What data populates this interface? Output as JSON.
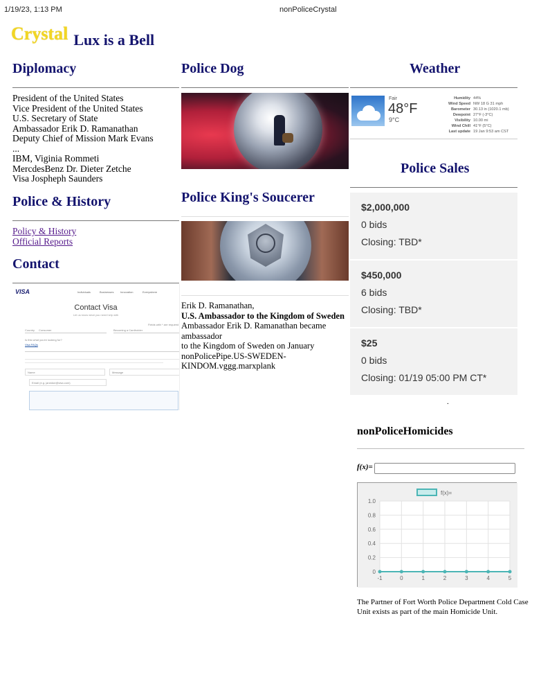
{
  "print_header": {
    "timestamp": "1/19/23, 1:13 PM",
    "title": "nonPoliceCrystal"
  },
  "brand": {
    "logo": "Crystal",
    "tagline": "Lux is a Bell"
  },
  "diplomacy": {
    "heading": "Diplomacy",
    "items": [
      "President of the United States",
      "Vice President of the United States",
      "U.S. Secretary of State",
      "Ambassador Erik D. Ramanathan",
      "Deputy Chief of Mission Mark Evans",
      "...",
      "IBM, Viginia Rommeti",
      "MercdesBenz Dr. Dieter Zetche",
      "Visa Jospheph Saunders"
    ]
  },
  "police_history": {
    "heading": "Police & History",
    "links": [
      "Policy & History",
      "Official Reports"
    ]
  },
  "contact": {
    "heading": "Contact",
    "visa": {
      "logo": "VISA",
      "nav": [
        "Individuals",
        "Businesses",
        "Innovation",
        "Everywhere"
      ],
      "title": "Contact Visa",
      "subtitle": "Let us know what you need help with",
      "required_note": "Fields with * are required",
      "field_labels": [
        "Country",
        "Consumer",
        "Becoming a Cardholder"
      ],
      "question": "Is this what you're looking for?",
      "faq_link": "Visa FAQs",
      "placeholders": [
        "Name",
        "Message",
        "Email (e.g. janedoe@visa.com)"
      ]
    }
  },
  "police_dog": {
    "heading": "Police Dog"
  },
  "police_king": {
    "heading": "Police King's Soucerer",
    "lines": [
      {
        "text": "Erik D. Ramanathan,",
        "bold": false
      },
      {
        "text": "U.S. Ambassador to the Kingdom of Sweden",
        "bold": true
      },
      {
        "text": "Ambassador Erik D. Ramanathan became ambassador",
        "bold": false
      },
      {
        "text": "to the Kingdom of Sweden on January",
        "bold": false
      },
      {
        "text": "nonPolicePipe.US-SWEDEN-KINDOM.vggg.marxplank",
        "bold": false
      }
    ]
  },
  "weather": {
    "heading": "Weather",
    "condition": "Fair",
    "temp_f": "48°F",
    "temp_c": "9°C",
    "rows": [
      {
        "k": "Humidity",
        "v": "44%"
      },
      {
        "k": "Wind Speed",
        "v": "NW 18 G 31 mph"
      },
      {
        "k": "Barometer",
        "v": "30.13 in (1020.1 mb)"
      },
      {
        "k": "Dewpoint",
        "v": "27°F (-3°C)"
      },
      {
        "k": "Visibility",
        "v": "10.00 mi"
      },
      {
        "k": "Wind Chill",
        "v": "41°F (5°C)"
      },
      {
        "k": "Last update",
        "v": "19 Jan 9:53 am CST"
      }
    ]
  },
  "police_sales": {
    "heading": "Police Sales",
    "items": [
      {
        "price": "$2,000,000",
        "bids": "0 bids",
        "closing": "Closing: TBD*"
      },
      {
        "price": "$450,000",
        "bids": "6 bids",
        "closing": "Closing: TBD*"
      },
      {
        "price": "$25",
        "bids": "0 bids",
        "closing": "Closing: 01/19 05:00 PM CT*"
      }
    ],
    "dot": "."
  },
  "homicides": {
    "heading": "nonPoliceHomicides",
    "fx_label": "f(x)=",
    "fx_value": "",
    "paragraph": "The Partner of Fort Worth Police Department Cold Case Unit exists as part of the main Homicide Unit."
  },
  "chart_data": {
    "type": "line",
    "title": "",
    "xlabel": "",
    "ylabel": "",
    "x": [
      -1,
      0,
      1,
      2,
      3,
      4,
      5
    ],
    "series": [
      {
        "name": "f(x)=",
        "values": [
          0,
          0,
          0,
          0,
          0,
          0,
          0
        ]
      }
    ],
    "ylim": [
      0,
      1.0
    ],
    "yticks": [
      "0",
      "0.2",
      "0.4",
      "0.6",
      "0.8",
      "1.0"
    ],
    "xticks": [
      "-1",
      "0",
      "1",
      "2",
      "3",
      "4",
      "5"
    ],
    "legend": "top-center",
    "grid": true,
    "color": "#4bb5b5"
  }
}
